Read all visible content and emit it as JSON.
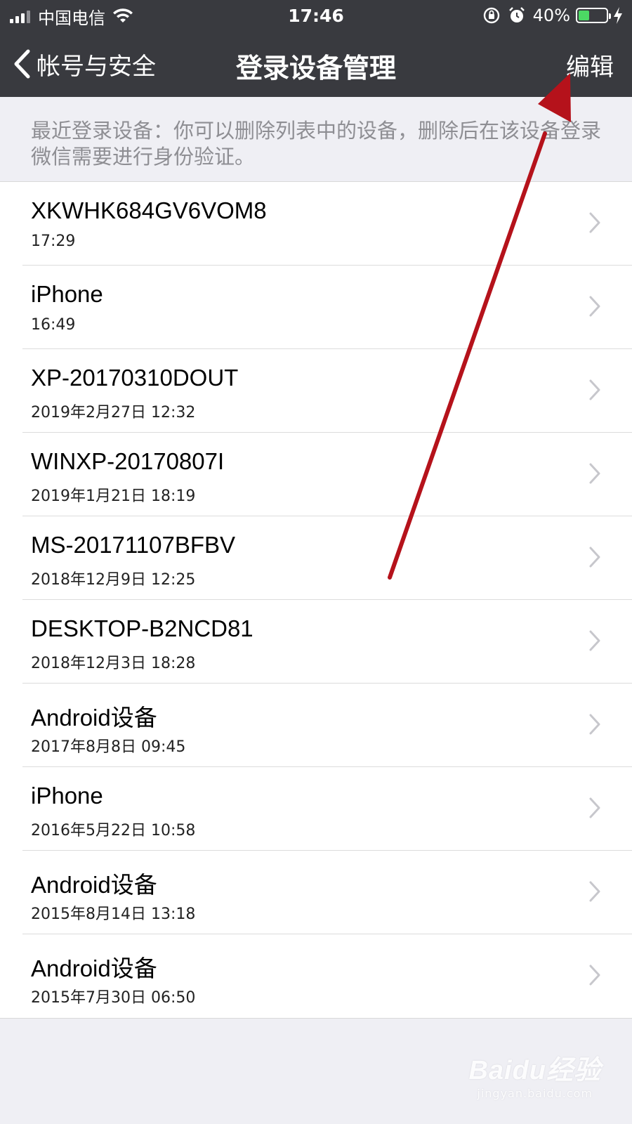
{
  "status_bar": {
    "carrier": "中国电信",
    "time": "17:46",
    "battery_percent": "40%",
    "battery_level": 0.4,
    "icons": [
      "signal-icon",
      "wifi-icon",
      "rotation-lock-icon",
      "alarm-icon",
      "battery-icon",
      "charging-icon"
    ]
  },
  "nav": {
    "back_label": "帐号与安全",
    "title": "登录设备管理",
    "edit_label": "编辑"
  },
  "hint": "最近登录设备：你可以删除列表中的设备，删除后在该设备登录微信需要进行身份验证。",
  "devices": [
    {
      "name": "XKWHK684GV6VOM8",
      "time": "17:29"
    },
    {
      "name": "iPhone",
      "time": "16:49"
    },
    {
      "name": "XP-20170310DOUT",
      "time": "2019年2月27日 12:32"
    },
    {
      "name": "WINXP-20170807I",
      "time": "2019年1月21日 18:19"
    },
    {
      "name": "MS-20171107BFBV",
      "time": "2018年12月9日 12:25"
    },
    {
      "name": "DESKTOP-B2NCD81",
      "time": "2018年12月3日 18:28"
    },
    {
      "name": "Android设备",
      "time": "2017年8月8日 09:45"
    },
    {
      "name": "iPhone",
      "time": "2016年5月22日 10:58"
    },
    {
      "name": "Android设备",
      "time": "2015年8月14日 13:18"
    },
    {
      "name": "Android设备",
      "time": "2015年7月30日 06:50"
    }
  ],
  "watermark": {
    "logo": "Baidu经验",
    "url": "jingyan.baidu.com"
  },
  "colors": {
    "nav_background": "#393a3f",
    "page_background": "#efeff4",
    "battery_fill": "#4cd964",
    "annotation_arrow": "#b5121b"
  }
}
